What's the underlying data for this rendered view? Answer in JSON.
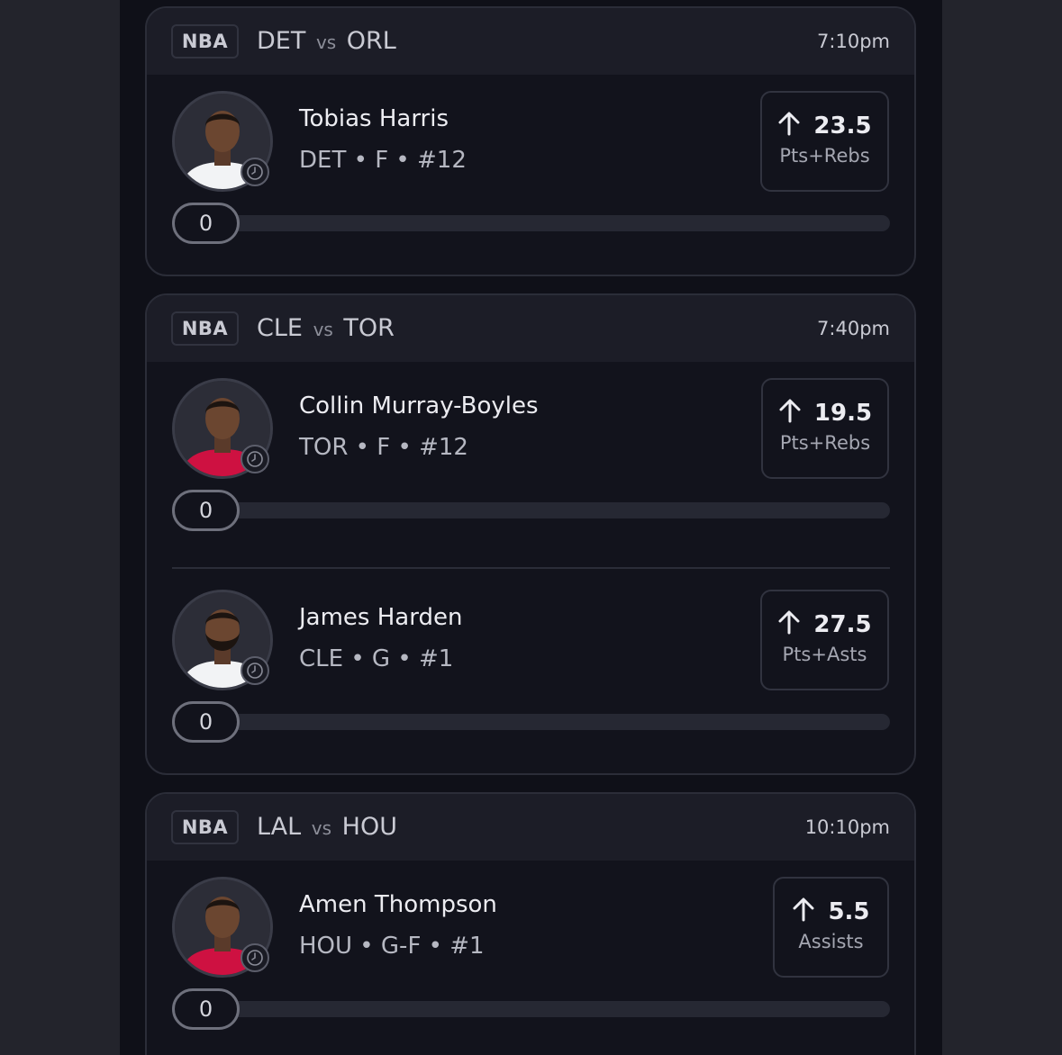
{
  "games": [
    {
      "league": "NBA",
      "team_a": "DET",
      "vs": "vs",
      "team_b": "ORL",
      "time": "7:10pm",
      "players": [
        {
          "name": "Tobias Harris",
          "info": "DET • F • #12",
          "line": "23.5",
          "stat": "Pts+Rebs",
          "progress_count": "0",
          "jersey_color": "#f2f3f5"
        }
      ]
    },
    {
      "league": "NBA",
      "team_a": "CLE",
      "vs": "vs",
      "team_b": "TOR",
      "time": "7:40pm",
      "players": [
        {
          "name": "Collin Murray-Boyles",
          "info": "TOR • F • #12",
          "line": "19.5",
          "stat": "Pts+Rebs",
          "progress_count": "0",
          "jersey_color": "#ce1141"
        },
        {
          "name": "James Harden",
          "info": "CLE • G • #1",
          "line": "27.5",
          "stat": "Pts+Asts",
          "progress_count": "0",
          "jersey_color": "#f2f3f5"
        }
      ]
    },
    {
      "league": "NBA",
      "team_a": "LAL",
      "vs": "vs",
      "team_b": "HOU",
      "time": "10:10pm",
      "players": [
        {
          "name": "Amen Thompson",
          "info": "HOU • G-F • #1",
          "line": "5.5",
          "stat": "Assists",
          "progress_count": "0",
          "jersey_color": "#ce1141"
        }
      ]
    }
  ],
  "icons": {
    "direction": "arrow-up-icon",
    "status": "clock-icon",
    "avatar": "player-headshot"
  },
  "colors": {
    "background": "#0f1018",
    "card_header": "#1c1d27",
    "card_border": "#2b2d38",
    "text_primary": "#ececf1"
  }
}
